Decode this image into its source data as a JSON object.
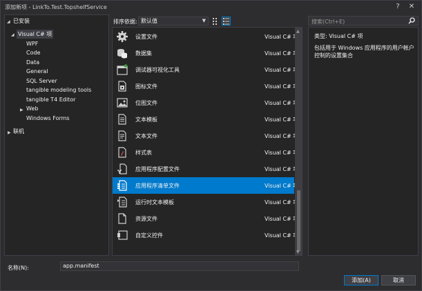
{
  "window": {
    "title": "添加新项 - LinkTo.Test.TopshelfService",
    "help": "?",
    "close": "✕"
  },
  "tree": {
    "installed": "已安装",
    "root": "Visual C# 项",
    "children": [
      "WPF",
      "Code",
      "Data",
      "General",
      "SQL Server",
      "tangible modeling tools",
      "tangible T4 Editor",
      "Web",
      "Windows Forms"
    ],
    "online": "联机"
  },
  "toolbar": {
    "sort_label": "排序依据:",
    "sort_value": "默认值"
  },
  "search": {
    "placeholder": "搜索(Ctrl+E)"
  },
  "items": [
    {
      "name": "设置文件",
      "type": "Visual C# 项",
      "icon": "gear-icon"
    },
    {
      "name": "数据集",
      "type": "Visual C# 项",
      "icon": "dataset-icon"
    },
    {
      "name": "调试器可视化工具",
      "type": "Visual C# 项",
      "icon": "visualizer-icon"
    },
    {
      "name": "图标文件",
      "type": "Visual C# 项",
      "icon": "icon-file-icon"
    },
    {
      "name": "位图文件",
      "type": "Visual C# 项",
      "icon": "bitmap-icon"
    },
    {
      "name": "文本模板",
      "type": "Visual C# 项",
      "icon": "text-template-icon"
    },
    {
      "name": "文本文件",
      "type": "Visual C# 项",
      "icon": "text-file-icon"
    },
    {
      "name": "样式表",
      "type": "Visual C# 项",
      "icon": "stylesheet-icon"
    },
    {
      "name": "应用程序配置文件",
      "type": "Visual C# 项",
      "icon": "config-file-icon"
    },
    {
      "name": "应用程序清单文件",
      "type": "Visual C# 项",
      "icon": "manifest-icon"
    },
    {
      "name": "运行时文本模板",
      "type": "Visual C# 项",
      "icon": "runtime-template-icon"
    },
    {
      "name": "资源文件",
      "type": "Visual C# 项",
      "icon": "resource-file-icon"
    },
    {
      "name": "自定义控件",
      "type": "Visual C# 项",
      "icon": "custom-control-icon"
    }
  ],
  "details": {
    "type_label": "类型: Visual C# 项",
    "description": "包括用于 Windows 应用程序的用户帐户控制的设置集合"
  },
  "name_field": {
    "label": "名称(N):",
    "value": "app.manifest"
  },
  "buttons": {
    "add": "添加(A)",
    "cancel": "取消"
  },
  "colors": {
    "accent": "#007acc",
    "background": "#2d2d30",
    "panel": "#252526"
  }
}
